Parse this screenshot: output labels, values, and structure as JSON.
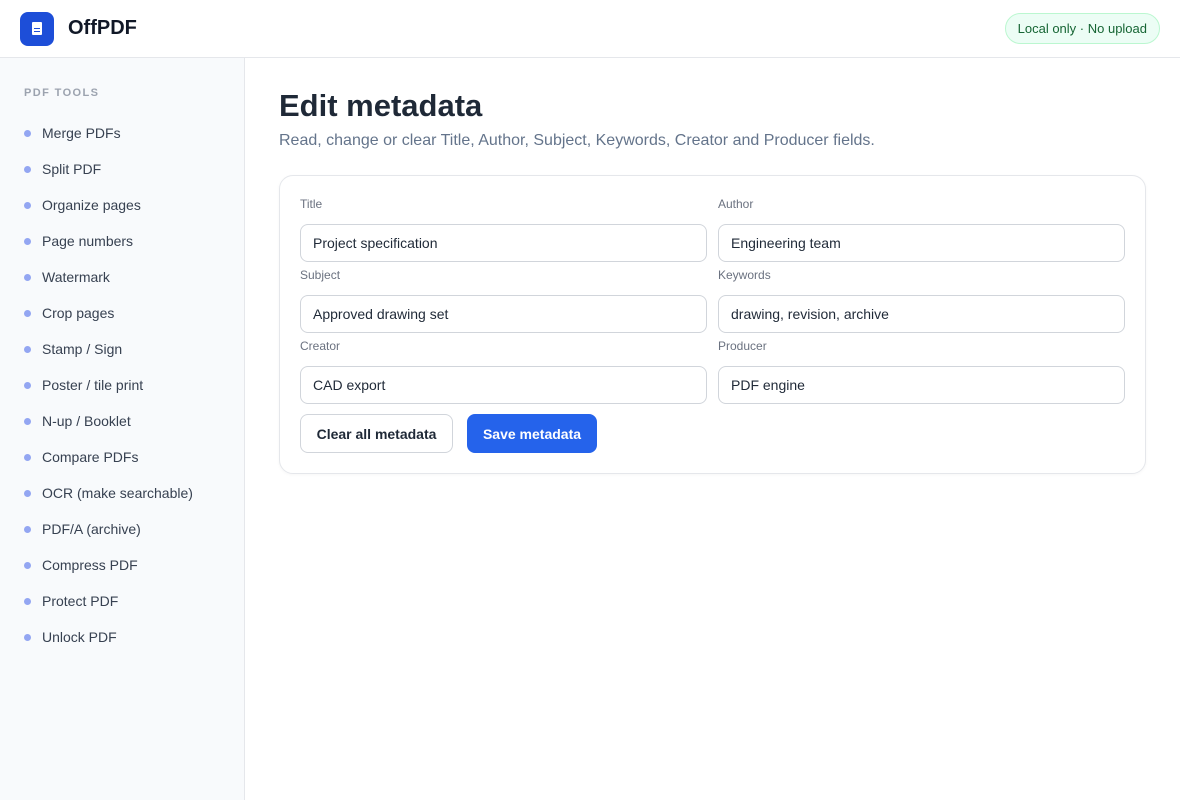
{
  "app": {
    "name": "OffPDF",
    "badge": "Local only · No upload",
    "logo_icon": "document-icon",
    "accent_color": "#2563eb"
  },
  "sidebar": {
    "heading": "PDF TOOLS",
    "items": [
      {
        "label": "Merge PDFs"
      },
      {
        "label": "Split PDF"
      },
      {
        "label": "Organize pages"
      },
      {
        "label": "Page numbers"
      },
      {
        "label": "Watermark"
      },
      {
        "label": "Crop pages"
      },
      {
        "label": "Stamp / Sign"
      },
      {
        "label": "Poster / tile print"
      },
      {
        "label": "N-up / Booklet"
      },
      {
        "label": "Compare PDFs"
      },
      {
        "label": "OCR (make searchable)"
      },
      {
        "label": "PDF/A (archive)"
      },
      {
        "label": "Compress PDF"
      },
      {
        "label": "Protect PDF"
      },
      {
        "label": "Unlock PDF"
      }
    ]
  },
  "main": {
    "title": "Edit metadata",
    "subtitle": "Read, change or clear Title, Author, Subject, Keywords, Creator and Producer fields."
  },
  "form": {
    "title": {
      "label": "Title",
      "value": "Project specification"
    },
    "author": {
      "label": "Author",
      "value": "Engineering team"
    },
    "subject": {
      "label": "Subject",
      "value": "Approved drawing set"
    },
    "keywords": {
      "label": "Keywords",
      "value": "drawing, revision, archive"
    },
    "creator": {
      "label": "Creator",
      "value": "CAD export"
    },
    "producer": {
      "label": "Producer",
      "value": "PDF engine"
    },
    "clear_label": "Clear all metadata",
    "save_label": "Save metadata"
  }
}
